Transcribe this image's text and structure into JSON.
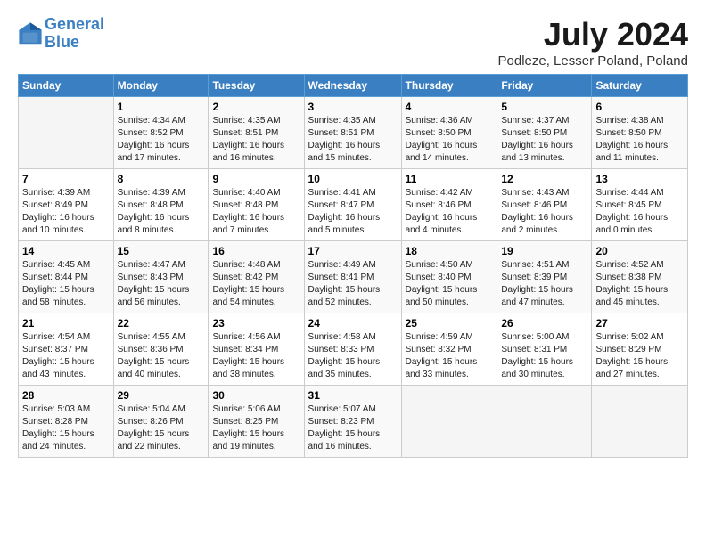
{
  "header": {
    "logo_line1": "General",
    "logo_line2": "Blue",
    "month_title": "July 2024",
    "location": "Podleze, Lesser Poland, Poland"
  },
  "columns": [
    "Sunday",
    "Monday",
    "Tuesday",
    "Wednesday",
    "Thursday",
    "Friday",
    "Saturday"
  ],
  "weeks": [
    [
      {
        "day": "",
        "content": ""
      },
      {
        "day": "1",
        "content": "Sunrise: 4:34 AM\nSunset: 8:52 PM\nDaylight: 16 hours\nand 17 minutes."
      },
      {
        "day": "2",
        "content": "Sunrise: 4:35 AM\nSunset: 8:51 PM\nDaylight: 16 hours\nand 16 minutes."
      },
      {
        "day": "3",
        "content": "Sunrise: 4:35 AM\nSunset: 8:51 PM\nDaylight: 16 hours\nand 15 minutes."
      },
      {
        "day": "4",
        "content": "Sunrise: 4:36 AM\nSunset: 8:50 PM\nDaylight: 16 hours\nand 14 minutes."
      },
      {
        "day": "5",
        "content": "Sunrise: 4:37 AM\nSunset: 8:50 PM\nDaylight: 16 hours\nand 13 minutes."
      },
      {
        "day": "6",
        "content": "Sunrise: 4:38 AM\nSunset: 8:50 PM\nDaylight: 16 hours\nand 11 minutes."
      }
    ],
    [
      {
        "day": "7",
        "content": "Sunrise: 4:39 AM\nSunset: 8:49 PM\nDaylight: 16 hours\nand 10 minutes."
      },
      {
        "day": "8",
        "content": "Sunrise: 4:39 AM\nSunset: 8:48 PM\nDaylight: 16 hours\nand 8 minutes."
      },
      {
        "day": "9",
        "content": "Sunrise: 4:40 AM\nSunset: 8:48 PM\nDaylight: 16 hours\nand 7 minutes."
      },
      {
        "day": "10",
        "content": "Sunrise: 4:41 AM\nSunset: 8:47 PM\nDaylight: 16 hours\nand 5 minutes."
      },
      {
        "day": "11",
        "content": "Sunrise: 4:42 AM\nSunset: 8:46 PM\nDaylight: 16 hours\nand 4 minutes."
      },
      {
        "day": "12",
        "content": "Sunrise: 4:43 AM\nSunset: 8:46 PM\nDaylight: 16 hours\nand 2 minutes."
      },
      {
        "day": "13",
        "content": "Sunrise: 4:44 AM\nSunset: 8:45 PM\nDaylight: 16 hours\nand 0 minutes."
      }
    ],
    [
      {
        "day": "14",
        "content": "Sunrise: 4:45 AM\nSunset: 8:44 PM\nDaylight: 15 hours\nand 58 minutes."
      },
      {
        "day": "15",
        "content": "Sunrise: 4:47 AM\nSunset: 8:43 PM\nDaylight: 15 hours\nand 56 minutes."
      },
      {
        "day": "16",
        "content": "Sunrise: 4:48 AM\nSunset: 8:42 PM\nDaylight: 15 hours\nand 54 minutes."
      },
      {
        "day": "17",
        "content": "Sunrise: 4:49 AM\nSunset: 8:41 PM\nDaylight: 15 hours\nand 52 minutes."
      },
      {
        "day": "18",
        "content": "Sunrise: 4:50 AM\nSunset: 8:40 PM\nDaylight: 15 hours\nand 50 minutes."
      },
      {
        "day": "19",
        "content": "Sunrise: 4:51 AM\nSunset: 8:39 PM\nDaylight: 15 hours\nand 47 minutes."
      },
      {
        "day": "20",
        "content": "Sunrise: 4:52 AM\nSunset: 8:38 PM\nDaylight: 15 hours\nand 45 minutes."
      }
    ],
    [
      {
        "day": "21",
        "content": "Sunrise: 4:54 AM\nSunset: 8:37 PM\nDaylight: 15 hours\nand 43 minutes."
      },
      {
        "day": "22",
        "content": "Sunrise: 4:55 AM\nSunset: 8:36 PM\nDaylight: 15 hours\nand 40 minutes."
      },
      {
        "day": "23",
        "content": "Sunrise: 4:56 AM\nSunset: 8:34 PM\nDaylight: 15 hours\nand 38 minutes."
      },
      {
        "day": "24",
        "content": "Sunrise: 4:58 AM\nSunset: 8:33 PM\nDaylight: 15 hours\nand 35 minutes."
      },
      {
        "day": "25",
        "content": "Sunrise: 4:59 AM\nSunset: 8:32 PM\nDaylight: 15 hours\nand 33 minutes."
      },
      {
        "day": "26",
        "content": "Sunrise: 5:00 AM\nSunset: 8:31 PM\nDaylight: 15 hours\nand 30 minutes."
      },
      {
        "day": "27",
        "content": "Sunrise: 5:02 AM\nSunset: 8:29 PM\nDaylight: 15 hours\nand 27 minutes."
      }
    ],
    [
      {
        "day": "28",
        "content": "Sunrise: 5:03 AM\nSunset: 8:28 PM\nDaylight: 15 hours\nand 24 minutes."
      },
      {
        "day": "29",
        "content": "Sunrise: 5:04 AM\nSunset: 8:26 PM\nDaylight: 15 hours\nand 22 minutes."
      },
      {
        "day": "30",
        "content": "Sunrise: 5:06 AM\nSunset: 8:25 PM\nDaylight: 15 hours\nand 19 minutes."
      },
      {
        "day": "31",
        "content": "Sunrise: 5:07 AM\nSunset: 8:23 PM\nDaylight: 15 hours\nand 16 minutes."
      },
      {
        "day": "",
        "content": ""
      },
      {
        "day": "",
        "content": ""
      },
      {
        "day": "",
        "content": ""
      }
    ]
  ]
}
